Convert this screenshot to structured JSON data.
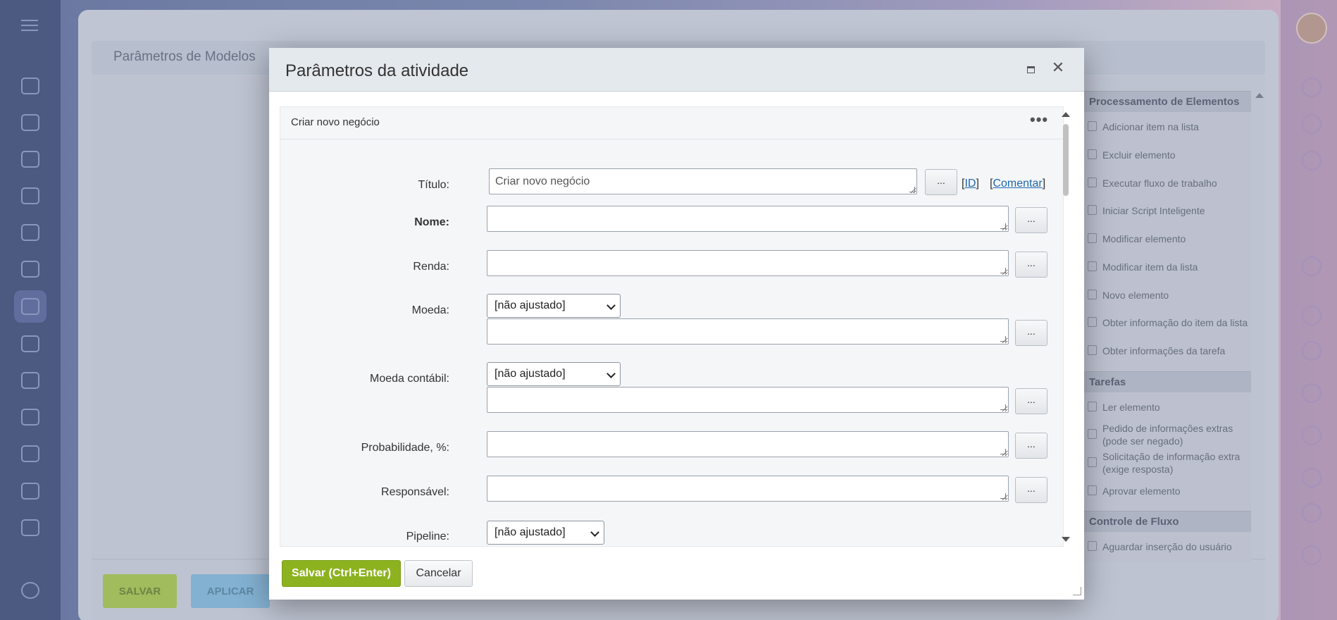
{
  "background": {
    "page_title": "Parâmetros de Modelos",
    "footer_buttons": {
      "save": "SALVAR",
      "apply": "APLICAR"
    },
    "toolbox": {
      "groups": [
        {
          "title": "Processamento de Elementos",
          "items": [
            "Adicionar item na lista",
            "Excluir elemento",
            "Executar fluxo de trabalho",
            "Iniciar Script Inteligente",
            "Modificar elemento",
            "Modificar item da lista",
            "Novo elemento",
            "Obter informação do item da lista",
            "Obter informações da tarefa"
          ]
        },
        {
          "title": "Tarefas",
          "items": [
            "Ler elemento",
            "Pedido de informações extras (pode ser negado)",
            "Solicitação de informação extra (exige resposta)",
            "Aprovar elemento"
          ]
        },
        {
          "title": "Controle de Fluxo",
          "items": [
            "Aguardar inserção do usuário"
          ]
        }
      ]
    }
  },
  "dialog": {
    "title": "Parâmetros da atividade",
    "activity_name": "Criar novo negócio",
    "more_label": "•••",
    "dots_label": "...",
    "fields": {
      "titulo": {
        "label": "Título:",
        "value": "Criar novo negócio",
        "id_link": "ID",
        "comment_link": "Comentar"
      },
      "nome": {
        "label": "Nome:",
        "value": ""
      },
      "renda": {
        "label": "Renda:",
        "value": ""
      },
      "moeda": {
        "label": "Moeda:",
        "select": "[não ajustado]",
        "value": ""
      },
      "moeda_contabil": {
        "label": "Moeda contábil:",
        "select": "[não ajustado]",
        "value": ""
      },
      "probabilidade": {
        "label": "Probabilidade, %:",
        "value": ""
      },
      "responsavel": {
        "label": "Responsável:",
        "value": ""
      },
      "pipeline": {
        "label": "Pipeline:",
        "select": "[não ajustado]"
      }
    },
    "buttons": {
      "save": "Salvar (Ctrl+Enter)",
      "cancel": "Cancelar"
    }
  },
  "colors": {
    "save_green": "#8db21f",
    "link_blue": "#2067b0",
    "dialog_header": "#e4e9ee"
  }
}
